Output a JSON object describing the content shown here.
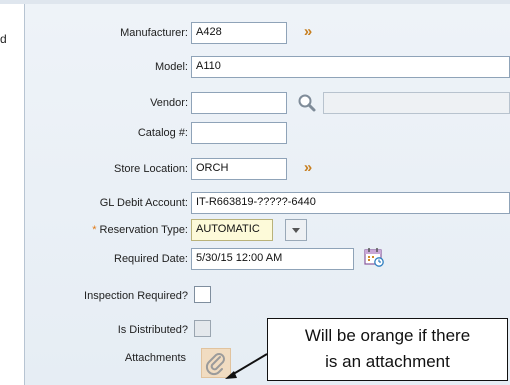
{
  "fields": {
    "manufacturer": {
      "label": "Manufacturer:",
      "value": "A428"
    },
    "model": {
      "label": "Model:",
      "value": "A110"
    },
    "vendor": {
      "label": "Vendor:",
      "value": ""
    },
    "catalog": {
      "label": "Catalog #:",
      "value": ""
    },
    "store_location": {
      "label": "Store Location:",
      "value": "ORCH"
    },
    "gl_debit": {
      "label": "GL Debit Account:",
      "value": "IT-R663819-?????-6440"
    },
    "reservation_type": {
      "label": "Reservation Type:",
      "value": "AUTOMATIC",
      "required_marker": "*"
    },
    "required_date": {
      "label": "Required Date:",
      "value": "5/30/15 12:00 AM"
    },
    "inspection_required": {
      "label": "Inspection Required?",
      "checked": false
    },
    "is_distributed": {
      "label": "Is Distributed?",
      "checked": false
    },
    "attachments": {
      "label": "Attachments",
      "has_attachment": true
    }
  },
  "corner_text": "d",
  "callout": {
    "line1": "Will be orange if there",
    "line2": "is an attachment"
  },
  "colors": {
    "accent_orange": "#c77e1f",
    "required_bg": "#fdfad9",
    "attachment_bg": "#f1dcc1"
  },
  "icons": [
    "double-chevron-right-icon",
    "magnifier-icon",
    "dropdown-arrow-icon",
    "calendar-icon",
    "paperclip-icon"
  ]
}
